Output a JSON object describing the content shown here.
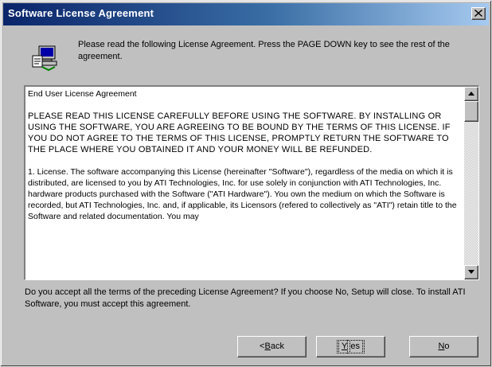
{
  "window": {
    "title": "Software License Agreement",
    "close_label": "×"
  },
  "header": {
    "icon": "computer-setup-icon",
    "instruction": "Please read the following License Agreement.  Press the PAGE DOWN key to see the rest of the agreement."
  },
  "license": {
    "heading": "End User License Agreement",
    "warning": "PLEASE READ THIS LICENSE CAREFULLY BEFORE USING THE SOFTWARE. BY INSTALLING OR USING THE SOFTWARE, YOU ARE AGREEING TO BE BOUND BY THE TERMS OF THIS LICENSE.  IF YOU DO NOT AGREE TO THE TERMS OF THIS LICENSE, PROMPTLY RETURN THE SOFTWARE TO THE PLACE WHERE YOU OBTAINED IT AND YOUR MONEY WILL BE REFUNDED.",
    "clause1": "1. License.  The software accompanying this License (hereinafter \"Software\"), regardless of the media on which it is distributed, are licensed to you by ATI Technologies, Inc. for use solely in conjunction with ATI Technologies, Inc. hardware products purchased with the Software (\"ATI Hardware\").  You own the medium on which the Software is recorded, but ATI Technologies, Inc. and, if applicable, its Licensors (refered to collectively as \"ATI\") retain title to the Software and related documentation.  You may"
  },
  "question": "Do you accept all the terms of the preceding License Agreement?  If you choose No,  Setup will close.  To install ATI Software, you must accept this agreement.",
  "buttons": {
    "back_mnemonic": "B",
    "back_prefix": "< ",
    "back_rest": "ack",
    "yes_mnemonic": "Y",
    "yes_rest": "es",
    "no_mnemonic": "N",
    "no_rest": "o"
  },
  "colors": {
    "face": "#c0c0c0",
    "titlebar_start": "#0a246a",
    "titlebar_end": "#a6caf0"
  }
}
